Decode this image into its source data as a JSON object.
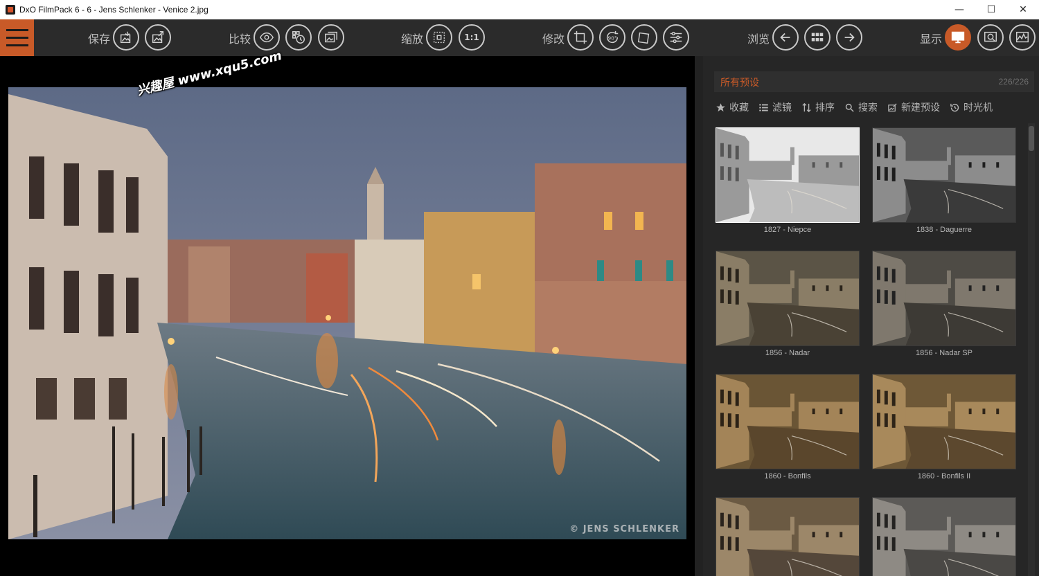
{
  "window": {
    "title": "DxO FilmPack 6 - 6 - Jens Schlenker - Venice 2.jpg",
    "controls": [
      "—",
      "☐",
      "✕"
    ]
  },
  "toolbar": {
    "save_label": "保存",
    "compare_label": "比较",
    "zoom_label": "缩放",
    "zoom_one_to_one": "1:1",
    "modify_label": "修改",
    "rotate_label": "90°",
    "browse_label": "浏览",
    "display_label": "显示"
  },
  "photo": {
    "copyright": "© JENS SCHLENKER"
  },
  "watermark": {
    "text": "兴趣屋 www.xqu5.com"
  },
  "panel": {
    "title": "所有预设",
    "count": "226/226",
    "tools": {
      "favorites": "收藏",
      "filters": "滤镜",
      "sort": "排序",
      "search": "搜索",
      "new_preset": "新建预设",
      "time_machine": "时光机"
    },
    "presets": [
      {
        "name": "1827 - Niepce",
        "tone": "niepce"
      },
      {
        "name": "1838 - Daguerre",
        "tone": "daguerre"
      },
      {
        "name": "1856 - Nadar",
        "tone": "nadar"
      },
      {
        "name": "1856 - Nadar SP",
        "tone": "nadarsp"
      },
      {
        "name": "1860 - Bonfils",
        "tone": "bonfils"
      },
      {
        "name": "1860 - Bonfils II",
        "tone": "bonfils2"
      },
      {
        "name": "",
        "tone": "sepia3"
      },
      {
        "name": "",
        "tone": "sepia4"
      }
    ]
  },
  "colors": {
    "accent": "#c85a28",
    "toolbar_bg": "#2b2b2b",
    "panel_bg": "#262626"
  }
}
